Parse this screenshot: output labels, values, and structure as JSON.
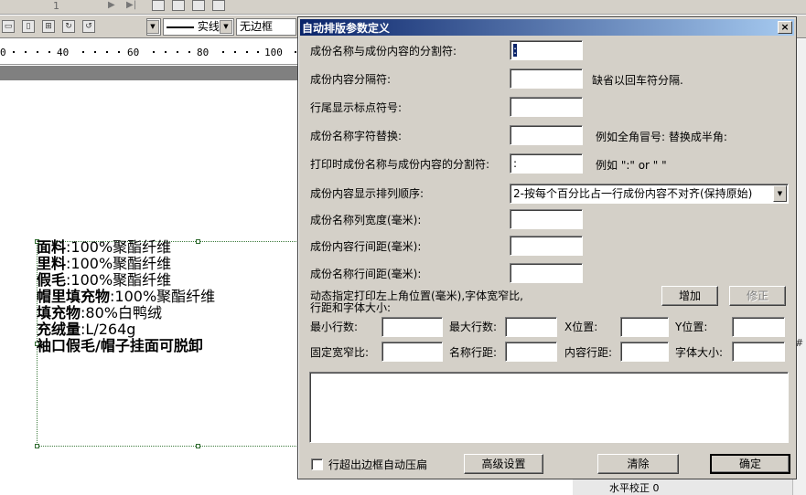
{
  "editor": {
    "page_number": "1",
    "border_style": "实线",
    "border_option": "无边框",
    "ruler_ticks": [
      "0",
      "40",
      "60",
      "80",
      "100"
    ],
    "labels": [
      {
        "name": "面料",
        "value": "100%聚酯纤维"
      },
      {
        "name": "里料",
        "value": "100%聚酯纤维"
      },
      {
        "name": "假毛",
        "value": "100%聚酯纤维"
      },
      {
        "name": "帽里填充物",
        "value": "100%聚酯纤维"
      },
      {
        "name": "填充物",
        "value": "80%白鸭绒"
      },
      {
        "name": "充绒量",
        "value": "L/264g"
      },
      {
        "name": "袖口假毛/帽子挂面可脱卸",
        "value": ""
      }
    ],
    "bottom_field_label": "水平校正",
    "bottom_field_value": "0",
    "right_mark": "#"
  },
  "dialog": {
    "title": "自动排版参数定义",
    "close_symbol": "×",
    "fields": {
      "name_content_separator": {
        "label": "成份名称与成份内容的分割符:",
        "value": ":"
      },
      "content_separator": {
        "label": "成份内容分隔符:",
        "value": "",
        "hint": "缺省以回车符分隔."
      },
      "line_end_punct": {
        "label": "行尾显示标点符号:",
        "value": ""
      },
      "name_char_replace": {
        "label": "成份名称字符替换:",
        "value": "",
        "hint": "例如全角冒号: 替换成半角:"
      },
      "print_separator": {
        "label": "打印时成份名称与成份内容的分割符:",
        "value": ":",
        "hint": "例如 \":\" or \" \""
      },
      "display_order": {
        "label": "成份内容显示排列顺序:",
        "value": "2-按每个百分比占一行成份内容不对齐(保持原始)"
      },
      "name_col_width": {
        "label": "成份名称列宽度(毫米):",
        "value": ""
      },
      "content_line_spacing": {
        "label": "成份内容行间距(毫米):",
        "value": ""
      },
      "name_line_spacing": {
        "label": "成份名称行间距(毫米):",
        "value": ""
      }
    },
    "dynamic_label_line1": "动态指定打印左上角位置(毫米),字体宽窄比,",
    "dynamic_label_line2": "行距和字体大小:",
    "add_button": "增加",
    "modify_button": "修正",
    "row1": {
      "min_lines": "最小行数:",
      "max_lines": "最大行数:",
      "x_pos": "X位置:",
      "y_pos": "Y位置:"
    },
    "row2": {
      "fixed_ratio": "固定宽窄比:",
      "name_spacing": "名称行距:",
      "content_spacing": "内容行距:",
      "font_size": "字体大小:"
    },
    "auto_compress_label": "行超出边框自动压扁",
    "advanced_button": "高级设置",
    "clear_button": "清除",
    "ok_button": "确定"
  }
}
